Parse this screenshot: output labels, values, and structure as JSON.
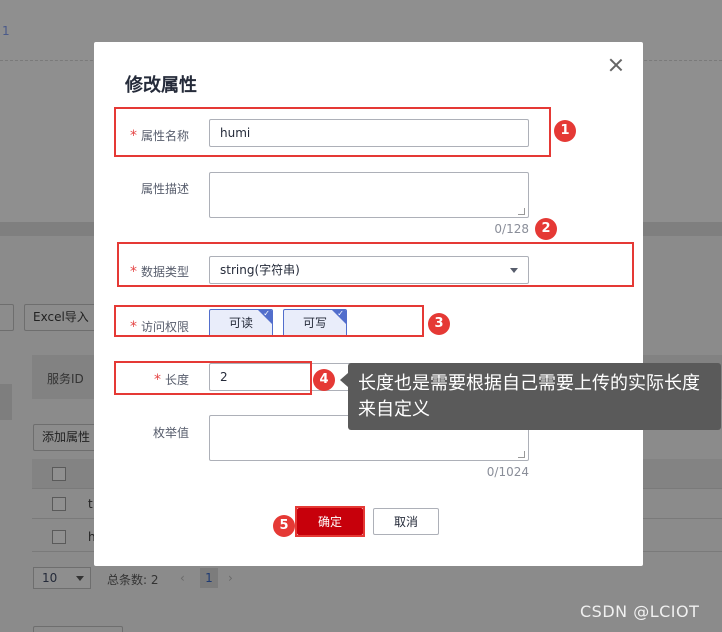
{
  "background": {
    "top_number": "1",
    "excel_import_label": "Excel导入",
    "service_id_header": "服务ID",
    "add_property_label": "添加属性",
    "row_cells": [
      "t",
      "h"
    ],
    "page_size": "10",
    "total_label": "总条数: 2",
    "current_page": "1"
  },
  "modal": {
    "title": "修改属性",
    "fields": {
      "name": {
        "label": "属性名称",
        "value": "humi"
      },
      "description": {
        "label": "属性描述",
        "value": "",
        "counter": "0/128"
      },
      "data_type": {
        "label": "数据类型",
        "value": "string(字符串)"
      },
      "access": {
        "label": "访问权限",
        "options": [
          "可读",
          "可写"
        ]
      },
      "length": {
        "label": "长度",
        "value": "2"
      },
      "enum": {
        "label": "枚举值",
        "value": "",
        "counter": "0/1024"
      }
    },
    "buttons": {
      "confirm": "确定",
      "cancel": "取消"
    }
  },
  "annotations": {
    "badges": [
      "1",
      "2",
      "3",
      "4",
      "5"
    ],
    "tooltip": "长度也是需要根据自己需要上传的实际长度来自定义"
  },
  "watermark": "CSDN @LCIOT",
  "colors": {
    "primary": "#c7000b",
    "annotation_red": "#e53935",
    "selected_blue": "#526ecc"
  }
}
